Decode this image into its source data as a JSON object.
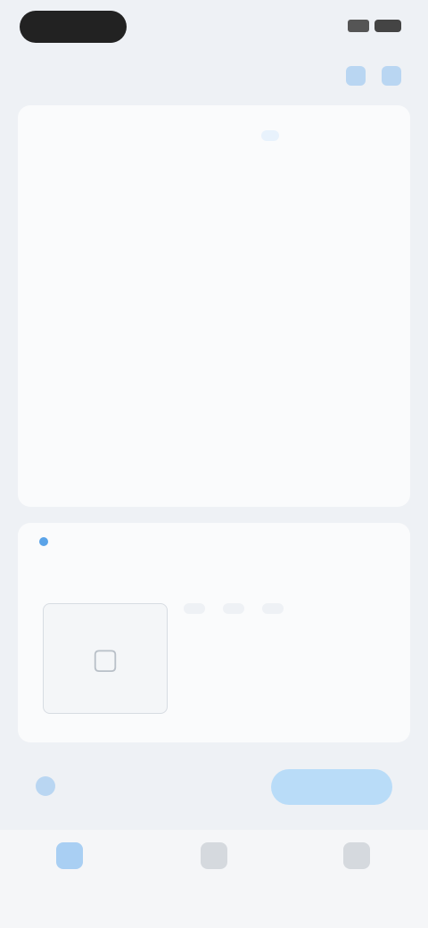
{
  "status": {
    "time": "",
    "signal": "signal-icon",
    "battery": "battery-icon"
  },
  "header": {
    "brand": "",
    "actions": [
      "share-icon",
      "more-icon"
    ]
  },
  "tabs": [
    {
      "label": ""
    },
    {
      "label": ""
    },
    {
      "label": ""
    },
    {
      "label": ""
    }
  ],
  "chart": {
    "title": "",
    "caption": ""
  },
  "dates": [
    "",
    "",
    "",
    "",
    "",
    "",
    ""
  ],
  "section": {
    "title": ""
  },
  "chips": [
    "",
    "",
    ""
  ],
  "info": [
    "",
    "",
    ""
  ],
  "action": {
    "label": "",
    "button": ""
  },
  "nav": [
    {
      "label": "",
      "icon": "home-icon"
    },
    {
      "label": "",
      "icon": "list-icon"
    },
    {
      "label": "",
      "icon": "profile-icon"
    }
  ],
  "colors": {
    "accent": "#5aa3e8",
    "background": "#eef1f5",
    "card": "#fafbfc"
  }
}
